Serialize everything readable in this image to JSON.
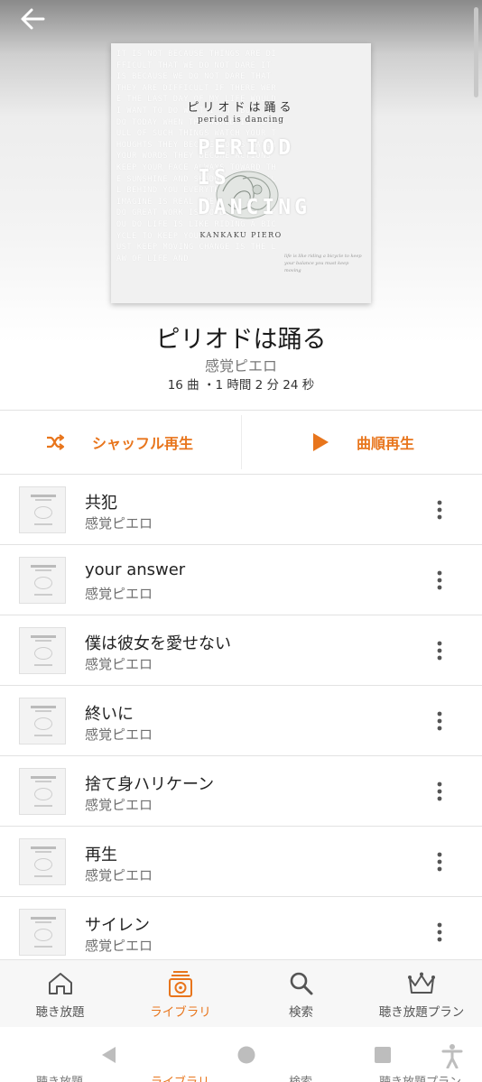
{
  "header": {
    "back_icon": "arrow-left-icon"
  },
  "album_art": {
    "jp_title": "ピリオドは踊る",
    "en_title": "period is dancing",
    "big_lines": [
      "PERIOD",
      "IS",
      "DANCING"
    ],
    "artist_caps": "KANKAKU PIERO",
    "bg_text": "IT IS NOT BECAUSE THINGS ARE DIFFICULT THAT WE DO NOT DARE IT IS BECAUSE WE DO NOT DARE THAT THEY ARE DIFFICULT IF THERE WERE THE LAST DAY OF MY LIFE WOULD I WANT TO DO WHAT I AM ABOUT TO DO TODAY WHEN THE WORLD IS SO FULL OF SUCH THINGS WATCH YOUR THOUGHTS THEY BECOME WORDS WATCH YOUR WORDS THEY BECOME ACTIONS KEEP YOUR FACE ALWAYS TOWARD THE SUNSHINE AND SHADOWS WILL FALL BEHIND YOU EVERYTHING YOU CAN IMAGINE IS REAL THE ONLY WAY TO DO GREAT WORK IS TO LOVE WHAT YOU DO LIFE IS LIKE RIDING A BICYCLE TO KEEP YOUR BALANCE YOU MUST KEEP MOVING CHANGE IS THE LAW OF LIFE AND",
    "small_text": "life is like riding a bicycle to keep your balance you must keep moving"
  },
  "album": {
    "title": "ピリオドは踊る",
    "artist": "感覚ピエロ",
    "meta": "16 曲 ・1 時間 2 分 24 秒"
  },
  "actions": {
    "shuffle_label": "シャッフル再生",
    "shuffle_icon": "shuffle-icon",
    "play_label": "曲順再生",
    "play_icon": "play-icon",
    "accent": "#e8751c"
  },
  "tracks": [
    {
      "title": "共犯",
      "artist": "感覚ピエロ"
    },
    {
      "title": "your answer",
      "artist": "感覚ピエロ"
    },
    {
      "title": "僕は彼女を愛せない",
      "artist": "感覚ピエロ"
    },
    {
      "title": "終いに",
      "artist": "感覚ピエロ"
    },
    {
      "title": "捨て身ハリケーン",
      "artist": "感覚ピエロ"
    },
    {
      "title": "再生",
      "artist": "感覚ピエロ"
    },
    {
      "title": "サイレン",
      "artist": "感覚ピエロ"
    }
  ],
  "bottom_nav": [
    {
      "label": "聴き放題",
      "icon": "home-icon",
      "active": false
    },
    {
      "label": "ライブラリ",
      "icon": "library-icon",
      "active": true
    },
    {
      "label": "検索",
      "icon": "search-icon",
      "active": false
    },
    {
      "label": "聴き放題プラン",
      "icon": "crown-icon",
      "active": false
    }
  ],
  "system_nav": {
    "back_icon": "triangle-back-icon",
    "home_icon": "circle-home-icon",
    "recents_icon": "square-recents-icon",
    "accessibility_icon": "accessibility-icon",
    "ghost_labels": [
      "聴き放題",
      "ライブラリ",
      "検索",
      "聴き放題プラン"
    ]
  }
}
